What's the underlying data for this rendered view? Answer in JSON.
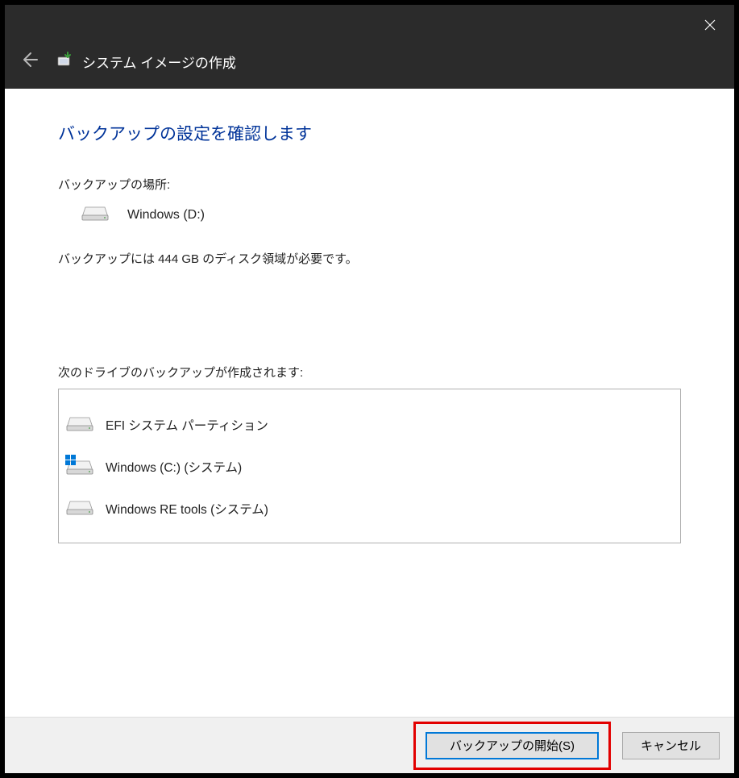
{
  "titlebar": {
    "title": "システム イメージの作成"
  },
  "page": {
    "heading": "バックアップの設定を確認します",
    "location_label": "バックアップの場所:",
    "location_name": "Windows (D:)",
    "size_text": "バックアップには 444 GB のディスク領域が必要です。",
    "drives_label": "次のドライブのバックアップが作成されます:",
    "drives": [
      {
        "name": "EFI システム パーティション",
        "is_system_drive": false
      },
      {
        "name": "Windows (C:) (システム)",
        "is_system_drive": true
      },
      {
        "name": "Windows RE tools (システム)",
        "is_system_drive": false
      }
    ]
  },
  "footer": {
    "start_label": "バックアップの開始(S)",
    "cancel_label": "キャンセル"
  }
}
